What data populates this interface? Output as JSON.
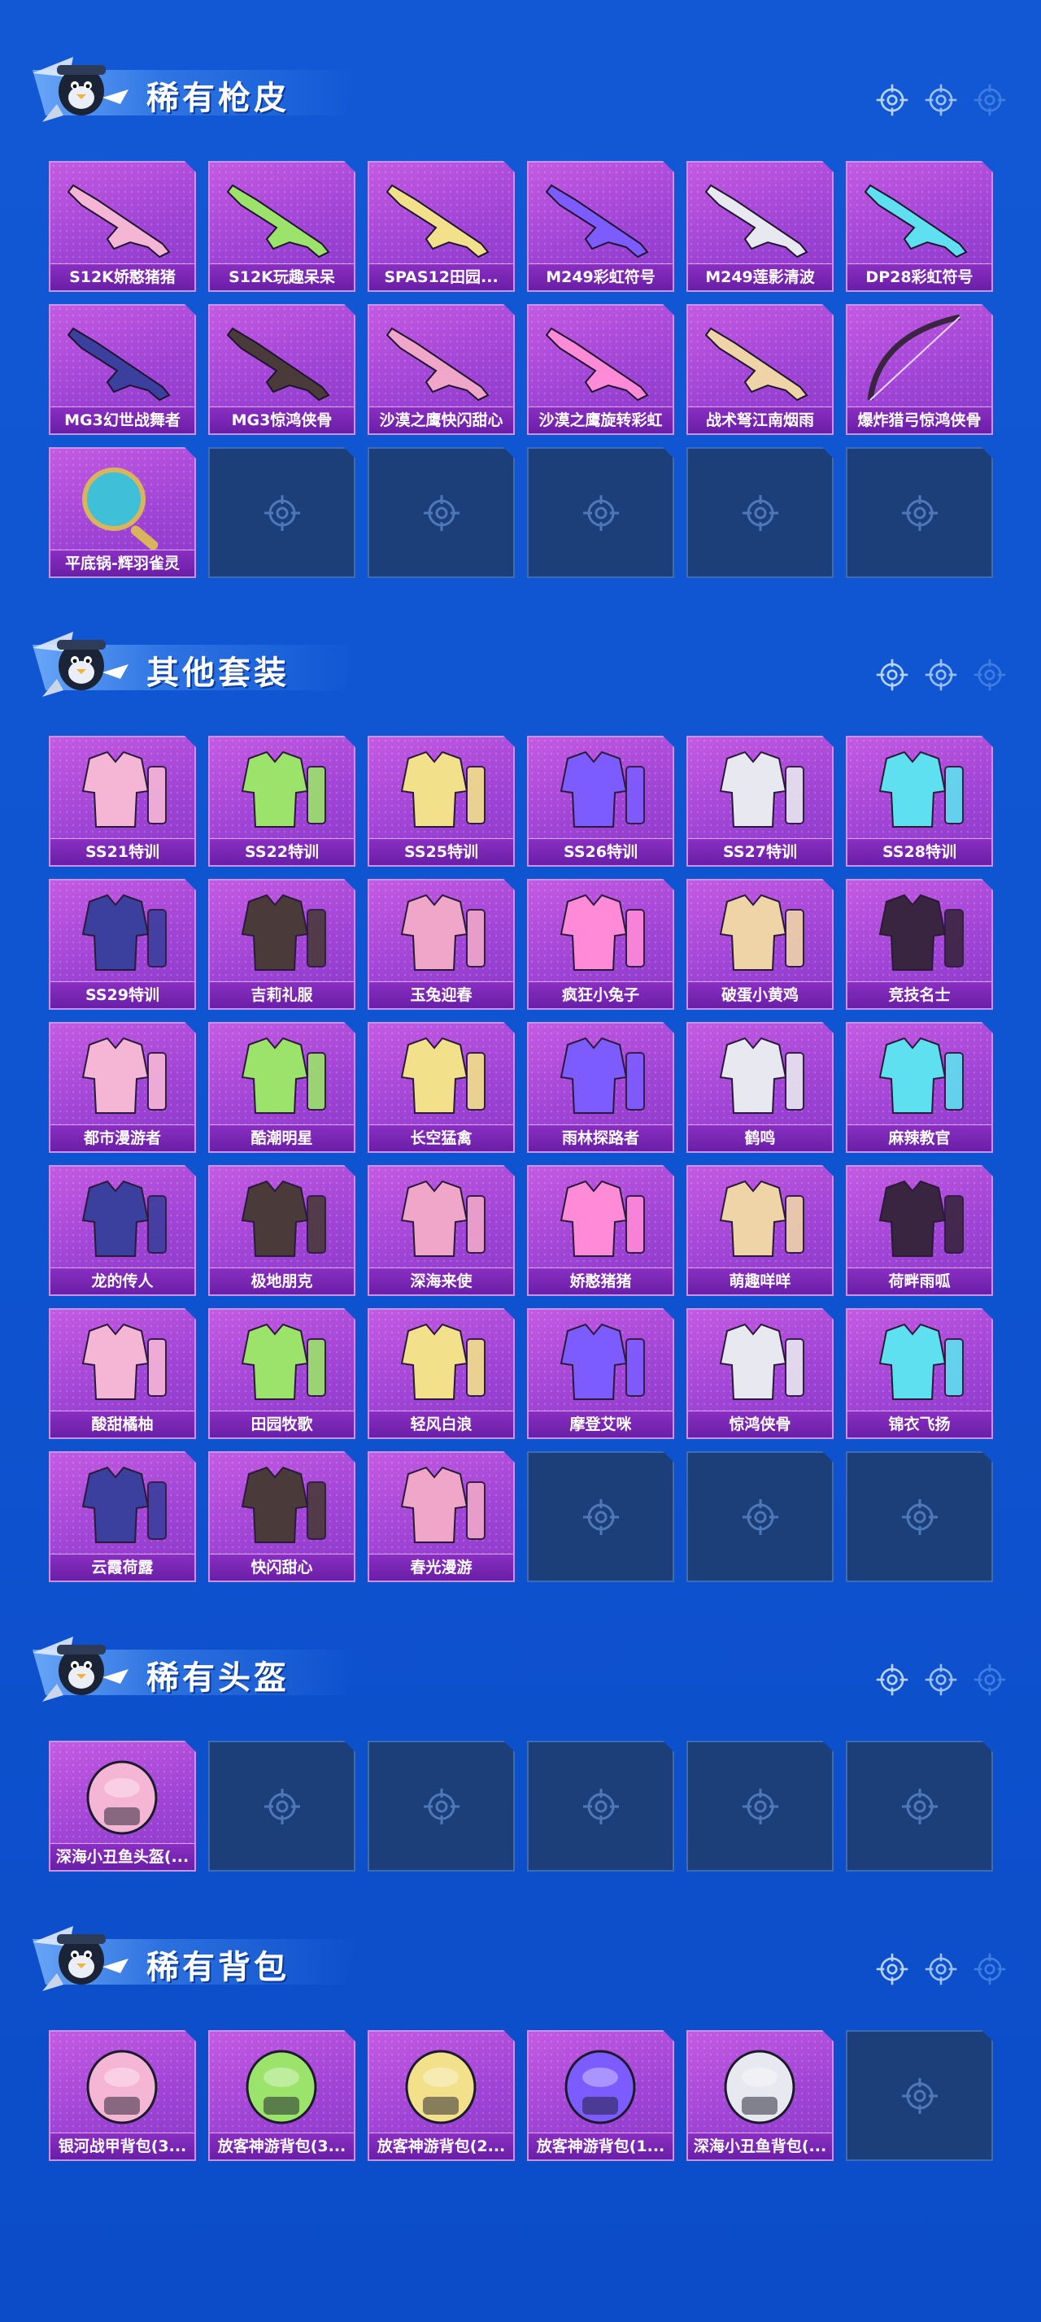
{
  "sections": [
    {
      "title": "稀有枪皮",
      "items": [
        {
          "name": "S12K娇憨猪猪",
          "icon": "shotgun-pink-icon"
        },
        {
          "name": "S12K玩趣呆呆",
          "icon": "shotgun-green-icon"
        },
        {
          "name": "SPAS12田园...",
          "icon": "shotgun-yellow-icon"
        },
        {
          "name": "M249彩虹符号",
          "icon": "machinegun-rainbow-icon"
        },
        {
          "name": "M249莲影清波",
          "icon": "machinegun-white-icon"
        },
        {
          "name": "DP28彩虹符号",
          "icon": "rifle-rainbow-icon"
        },
        {
          "name": "MG3幻世战舞者",
          "icon": "machinegun-blue-icon"
        },
        {
          "name": "MG3惊鸿侠骨",
          "icon": "machinegun-dark-icon"
        },
        {
          "name": "沙漠之鹰快闪甜心",
          "icon": "pistol-pink-icon"
        },
        {
          "name": "沙漠之鹰旋转彩虹",
          "icon": "pistol-rainbow-icon"
        },
        {
          "name": "战术弩江南烟雨",
          "icon": "crossbow-icon"
        },
        {
          "name": "爆炸猎弓惊鸿侠骨",
          "icon": "bow-icon"
        },
        {
          "name": "平底锅-辉羽雀灵",
          "icon": "pan-icon"
        }
      ]
    },
    {
      "title": "其他套装",
      "items": [
        {
          "name": "SS21特训",
          "icon": "outfit-green-icon"
        },
        {
          "name": "SS22特训",
          "icon": "outfit-white-icon"
        },
        {
          "name": "SS25特训",
          "icon": "outfit-blue-icon"
        },
        {
          "name": "SS26特训",
          "icon": "outfit-pink-icon"
        },
        {
          "name": "SS27特训",
          "icon": "outfit-black-yellow-icon"
        },
        {
          "name": "SS28特训",
          "icon": "outfit-purple-icon"
        },
        {
          "name": "SS29特训",
          "icon": "outfit-white-icon"
        },
        {
          "name": "吉莉礼服",
          "icon": "outfit-dress-icon"
        },
        {
          "name": "玉兔迎春",
          "icon": "outfit-red-icon"
        },
        {
          "name": "疯狂小兔子",
          "icon": "outfit-bunny-icon"
        },
        {
          "name": "破蛋小黄鸡",
          "icon": "outfit-chick-icon"
        },
        {
          "name": "竞技名士",
          "icon": "outfit-gray-icon"
        },
        {
          "name": "都市漫游者",
          "icon": "outfit-hoodie-icon"
        },
        {
          "name": "酷潮明星",
          "icon": "outfit-gold-icon"
        },
        {
          "name": "长空猛禽",
          "icon": "outfit-black-icon"
        },
        {
          "name": "雨林探路者",
          "icon": "outfit-jungle-icon"
        },
        {
          "name": "鹤鸣",
          "icon": "outfit-crane-icon"
        },
        {
          "name": "麻辣教官",
          "icon": "outfit-instructor-icon"
        },
        {
          "name": "龙的传人",
          "icon": "outfit-dragon-icon"
        },
        {
          "name": "极地朋克",
          "icon": "outfit-punk-icon"
        },
        {
          "name": "深海来使",
          "icon": "outfit-sea-icon"
        },
        {
          "name": "娇憨猪猪",
          "icon": "outfit-pig-icon"
        },
        {
          "name": "萌趣咩咩",
          "icon": "outfit-sheep-icon"
        },
        {
          "name": "荷畔雨呱",
          "icon": "outfit-frog-icon"
        },
        {
          "name": "酸甜橘柚",
          "icon": "outfit-orange-icon"
        },
        {
          "name": "田园牧歌",
          "icon": "outfit-pastoral-icon"
        },
        {
          "name": "轻风白浪",
          "icon": "outfit-wave-icon"
        },
        {
          "name": "摩登艾咪",
          "icon": "outfit-modern-icon"
        },
        {
          "name": "惊鸿侠骨",
          "icon": "outfit-hero-icon"
        },
        {
          "name": "锦衣飞扬",
          "icon": "outfit-robe-icon"
        },
        {
          "name": "云霞荷露",
          "icon": "outfit-cloud-icon"
        },
        {
          "name": "快闪甜心",
          "icon": "outfit-sweetheart-icon"
        },
        {
          "name": "春光漫游",
          "icon": "outfit-spring-icon"
        }
      ]
    },
    {
      "title": "稀有头盔",
      "items": [
        {
          "name": "深海小丑鱼头盔(...",
          "icon": "helmet-icon"
        }
      ]
    },
    {
      "title": "稀有背包",
      "items": [
        {
          "name": "银河战甲背包(3...",
          "icon": "backpack-galaxy-icon"
        },
        {
          "name": "放客神游背包(3...",
          "icon": "backpack-dog-icon"
        },
        {
          "name": "放客神游背包(2...",
          "icon": "backpack-dog-pink-icon"
        },
        {
          "name": "放客神游背包(1...",
          "icon": "backpack-dog-dark-icon"
        },
        {
          "name": "深海小丑鱼背包(...",
          "icon": "backpack-clownfish-icon"
        }
      ]
    }
  ],
  "colors": {
    "background": "#1258d4",
    "tile": "#a044d6",
    "tile_label": "#6a1ea6",
    "empty_tile": "#1c3f7a"
  }
}
